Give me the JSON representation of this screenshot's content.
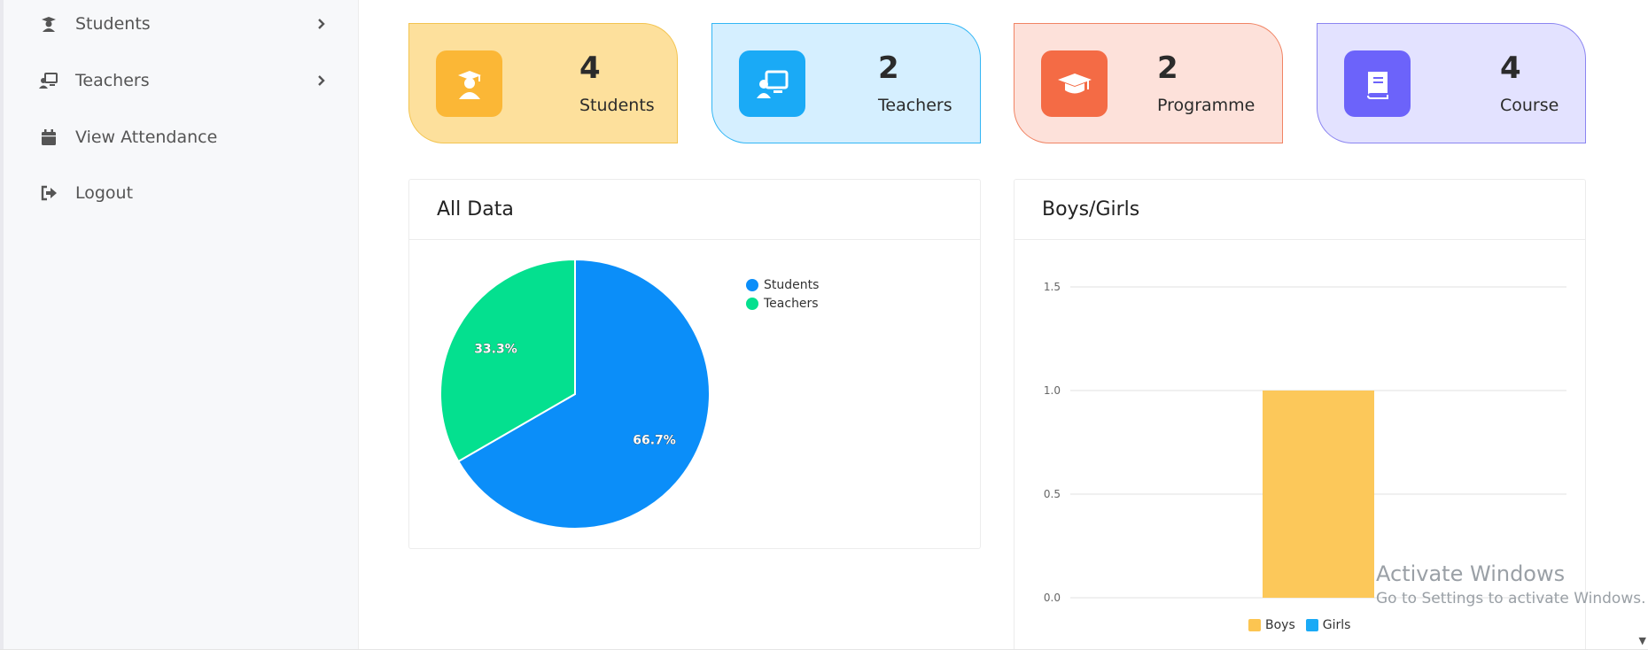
{
  "sidebar": {
    "items": [
      {
        "label": "Students",
        "icon": "student-icon"
      },
      {
        "label": "Teachers",
        "icon": "teacher-icon"
      },
      {
        "label": "View Attendance",
        "icon": "calendar-icon"
      },
      {
        "label": "Logout",
        "icon": "logout-icon"
      }
    ]
  },
  "stats": [
    {
      "value": "4",
      "label": "Students",
      "icon": "student-icon",
      "bg": "#fde09c",
      "border": "#f3c450",
      "iconbg": "#fbb736"
    },
    {
      "value": "2",
      "label": "Teachers",
      "icon": "teacher-board-icon",
      "bg": "#d5efff",
      "border": "#32b6f5",
      "iconbg": "#1aaaf6"
    },
    {
      "value": "2",
      "label": "Programme",
      "icon": "graduation-cap-icon",
      "bg": "#fde1da",
      "border": "#f08464",
      "iconbg": "#f46b45"
    },
    {
      "value": "4",
      "label": "Course",
      "icon": "book-icon",
      "bg": "#e3e2ff",
      "border": "#8b85f1",
      "iconbg": "#6c63fa"
    }
  ],
  "panels": {
    "all_data_title": "All Data",
    "boys_girls_title": "Boys/Girls"
  },
  "watermark": {
    "line1": "Activate Windows",
    "line2": "Go to Settings to activate Windows."
  },
  "chart_data": [
    {
      "type": "pie",
      "title": "All Data",
      "categories": [
        "Students",
        "Teachers"
      ],
      "values": [
        4,
        2
      ],
      "labels": [
        "66.7%",
        "33.3%"
      ],
      "colors": [
        "#0b8ef9",
        "#04e08f"
      ],
      "legend": "top-right"
    },
    {
      "type": "bar",
      "title": "Boys/Girls",
      "categories": [
        ""
      ],
      "series": [
        {
          "name": "Boys",
          "values": [
            1
          ],
          "color": "#fcc551"
        },
        {
          "name": "Girls",
          "values": [
            0
          ],
          "color": "#1aaaf6"
        }
      ],
      "ylim": [
        0,
        1.5
      ],
      "yticks": [
        "0.0",
        "0.5",
        "1.0",
        "1.5"
      ],
      "grid": true,
      "legend": "bottom"
    }
  ]
}
